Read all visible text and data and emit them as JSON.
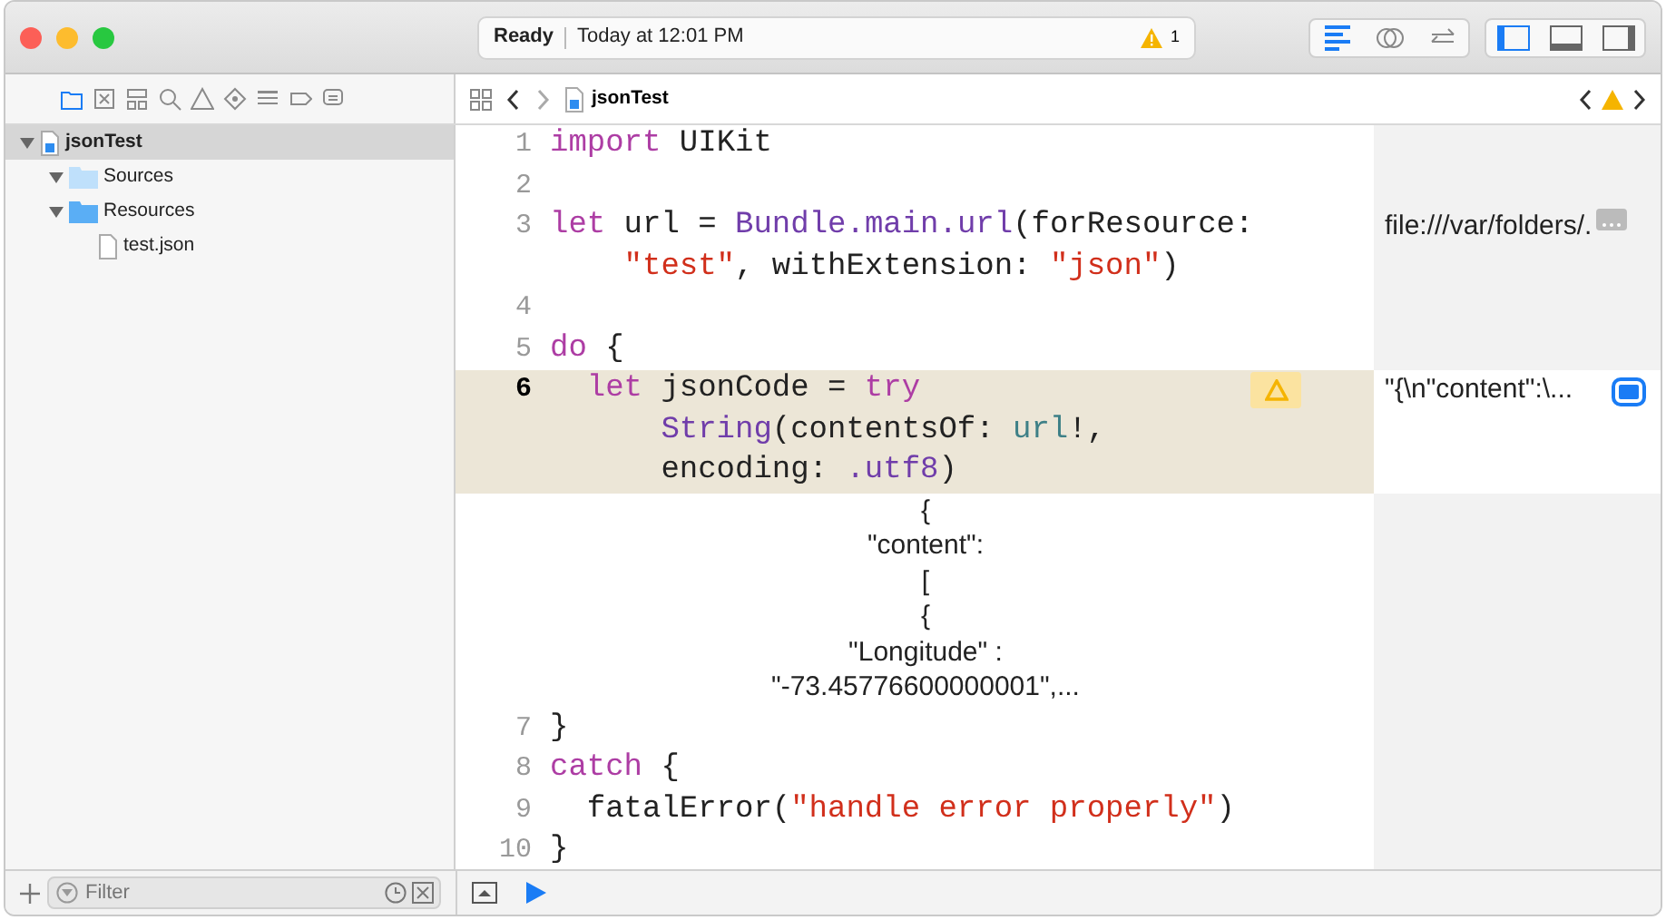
{
  "toolbar": {
    "status": "Ready",
    "time": "Today at 12:01 PM",
    "warning_count": "1",
    "editor_modes": [
      {
        "kind": "standard",
        "selected": true
      },
      {
        "kind": "assistant",
        "selected": false
      },
      {
        "kind": "version",
        "selected": false
      }
    ],
    "panels": [
      {
        "kind": "navigator",
        "on": true
      },
      {
        "kind": "debug",
        "on": false
      },
      {
        "kind": "utilities",
        "on": false
      }
    ]
  },
  "navigator": {
    "tabs": [
      {
        "kind": "project",
        "selected": true
      },
      {
        "kind": "source",
        "selected": false
      },
      {
        "kind": "symbol",
        "selected": false
      },
      {
        "kind": "find",
        "selected": false
      },
      {
        "kind": "issue",
        "selected": false
      },
      {
        "kind": "test",
        "selected": false
      },
      {
        "kind": "debug",
        "selected": false
      },
      {
        "kind": "breakpoint",
        "selected": false
      },
      {
        "kind": "report",
        "selected": false
      }
    ],
    "tree": [
      {
        "label": "jsonTest",
        "kind": "project",
        "expanded": true,
        "selected": true,
        "children": [
          {
            "label": "Sources",
            "kind": "folder",
            "expanded": true,
            "selected": false
          },
          {
            "label": "Resources",
            "kind": "folder",
            "expanded": true,
            "selected": false,
            "children": [
              {
                "label": "test.json",
                "kind": "file",
                "selected": false
              }
            ]
          }
        ]
      }
    ],
    "filter": {
      "placeholder": "Filter"
    }
  },
  "jump_bar": {
    "crumb": "jsonTest"
  },
  "editor": {
    "lines": [
      {
        "number": "1",
        "current": false,
        "wraps": [
          {
            "kind": "top",
            "tokens": [
              {
                "kind": "keyword",
                "text": "import"
              },
              {
                "kind": "plain",
                "text": " UIKit"
              }
            ]
          }
        ]
      },
      {
        "number": "2",
        "current": false
      },
      {
        "number": "3",
        "current": false,
        "wraps": [
          {
            "kind": "top",
            "tokens": [
              {
                "kind": "keyword",
                "text": "let"
              },
              {
                "kind": "plain",
                "text": " url = "
              },
              {
                "kind": "type",
                "text": "Bundle.main.url"
              },
              {
                "kind": "plain",
                "text": "(forResource:"
              }
            ]
          },
          {
            "kind": "wrap",
            "tokens": [
              {
                "kind": "string",
                "text": "\"test\""
              },
              {
                "kind": "plain",
                "text": ", withExtension: "
              },
              {
                "kind": "string",
                "text": "\"json\""
              },
              {
                "kind": "plain",
                "text": ")"
              }
            ]
          }
        ],
        "result": {
          "text": "file:///var/folders/.",
          "kind": "more"
        }
      },
      {
        "number": "4",
        "current": false
      },
      {
        "number": "5",
        "current": false,
        "wraps": [
          {
            "kind": "top",
            "tokens": [
              {
                "kind": "keyword",
                "text": "do"
              },
              {
                "kind": "plain",
                "text": " {"
              }
            ]
          }
        ]
      },
      {
        "number": "6",
        "current": true,
        "warning": true,
        "wraps": [
          {
            "kind": "nested",
            "tokens": [
              {
                "kind": "keyword",
                "text": "let"
              },
              {
                "kind": "plain",
                "text": " jsonCode = "
              },
              {
                "kind": "keyword",
                "text": "try"
              }
            ]
          },
          {
            "kind": "nested_wrap",
            "tokens": [
              {
                "kind": "type",
                "text": "String"
              },
              {
                "kind": "plain",
                "text": "(contentsOf: "
              },
              {
                "kind": "variable",
                "text": "url"
              },
              {
                "kind": "plain",
                "text": "!,"
              }
            ]
          },
          {
            "kind": "nested_wrap",
            "tokens": [
              {
                "kind": "plain",
                "text": "encoding: "
              },
              {
                "kind": "type",
                "text": ".utf8"
              },
              {
                "kind": "plain",
                "text": ")"
              }
            ]
          }
        ],
        "result": {
          "text": "\"{\\n\"content\":\\...",
          "kind": "quicklook"
        },
        "inline_result": [
          "{",
          "\"content\":",
          "[",
          "{",
          "\"Longitude\" :",
          "\"-73.45776600000001\",..."
        ]
      },
      {
        "number": "7",
        "current": false,
        "wraps": [
          {
            "kind": "top",
            "tokens": [
              {
                "kind": "plain",
                "text": "}"
              }
            ]
          }
        ]
      },
      {
        "number": "8",
        "current": false,
        "wraps": [
          {
            "kind": "top",
            "tokens": [
              {
                "kind": "keyword",
                "text": "catch"
              },
              {
                "kind": "plain",
                "text": " {"
              }
            ]
          }
        ]
      },
      {
        "number": "9",
        "current": false,
        "wraps": [
          {
            "kind": "nested",
            "tokens": [
              {
                "kind": "plain",
                "text": "fatalError("
              },
              {
                "kind": "string",
                "text": "\"handle error properly\""
              },
              {
                "kind": "plain",
                "text": ")"
              }
            ]
          }
        ]
      },
      {
        "number": "10",
        "current": false,
        "wraps": [
          {
            "kind": "top",
            "tokens": [
              {
                "kind": "plain",
                "text": "}"
              }
            ]
          }
        ]
      }
    ]
  }
}
